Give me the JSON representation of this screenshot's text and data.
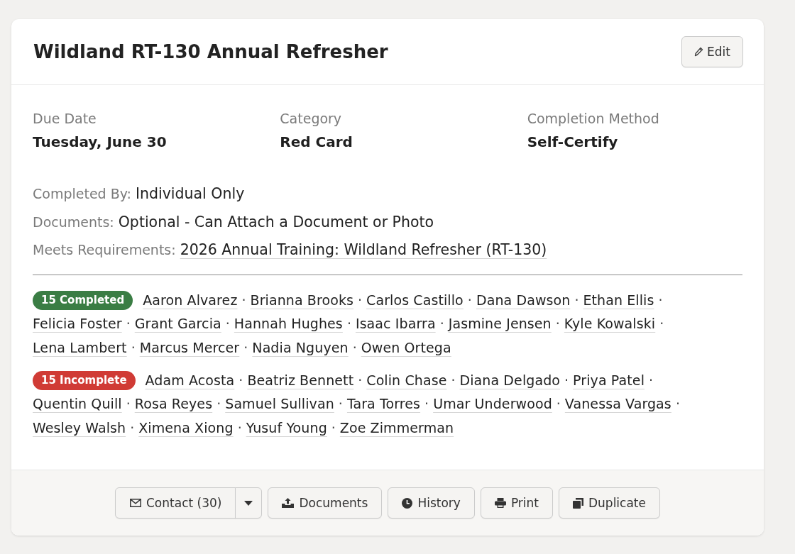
{
  "card": {
    "title": "Wildland RT-130 Annual Refresher",
    "edit_button": "Edit"
  },
  "fields": [
    {
      "label": "Due Date",
      "value": "Tuesday, June 30"
    },
    {
      "label": "Category",
      "value": "Red Card"
    },
    {
      "label": "Completion Method",
      "value": "Self-Certify"
    }
  ],
  "details": [
    {
      "label": "Completed By:",
      "value": "Individual Only",
      "kind": "text"
    },
    {
      "label": "Documents:",
      "value": "Optional - Can Attach a Document or Photo",
      "kind": "text"
    },
    {
      "label": "Meets Requirements:",
      "value": "2026 Annual Training: Wildland Refresher (RT-130)",
      "kind": "link"
    }
  ],
  "groups": [
    {
      "badge": "15 Completed",
      "color": "#3a7d44",
      "people": [
        {
          "name": "Aaron Alvarez",
          "separator": "·"
        },
        {
          "name": "Brianna Brooks",
          "separator": "·"
        },
        {
          "name": "Carlos Castillo",
          "separator": "·"
        },
        {
          "name": "Dana Dawson",
          "separator": "·"
        },
        {
          "name": "Ethan Ellis",
          "separator": "·"
        },
        {
          "name": "Felicia Foster",
          "separator": "·"
        },
        {
          "name": "Grant Garcia",
          "separator": "·"
        },
        {
          "name": "Hannah Hughes",
          "separator": "·"
        },
        {
          "name": "Isaac Ibarra",
          "separator": "·"
        },
        {
          "name": "Jasmine Jensen",
          "separator": "·"
        },
        {
          "name": "Kyle Kowalski",
          "separator": "·"
        },
        {
          "name": "Lena Lambert",
          "separator": "·"
        },
        {
          "name": "Marcus Mercer",
          "separator": "·"
        },
        {
          "name": "Nadia Nguyen",
          "separator": "·"
        },
        {
          "name": "Owen Ortega"
        }
      ]
    },
    {
      "badge": "15 Incomplete",
      "color": "#d03b35",
      "people": [
        {
          "name": "Adam Acosta",
          "separator": "·"
        },
        {
          "name": "Beatriz Bennett",
          "separator": "·"
        },
        {
          "name": "Colin Chase",
          "separator": "·"
        },
        {
          "name": "Diana Delgado",
          "separator": "·"
        },
        {
          "name": "Priya Patel",
          "separator": "·"
        },
        {
          "name": "Quentin Quill",
          "separator": "·"
        },
        {
          "name": "Rosa Reyes",
          "separator": "·"
        },
        {
          "name": "Samuel Sullivan",
          "separator": "·"
        },
        {
          "name": "Tara Torres",
          "separator": "·"
        },
        {
          "name": "Umar Underwood",
          "separator": "·"
        },
        {
          "name": "Vanessa Vargas",
          "separator": "·"
        },
        {
          "name": "Wesley Walsh",
          "separator": "·"
        },
        {
          "name": "Ximena Xiong",
          "separator": "·"
        },
        {
          "name": "Yusuf Young",
          "separator": "·"
        },
        {
          "name": "Zoe Zimmerman"
        }
      ]
    }
  ],
  "actions": [
    {
      "label": "Contact (30)",
      "kind": "split"
    },
    {
      "label": "Documents",
      "kind": "plain"
    },
    {
      "label": "History",
      "kind": "plain"
    },
    {
      "label": "Print",
      "kind": "plain"
    },
    {
      "label": "Duplicate",
      "kind": "plain"
    }
  ]
}
